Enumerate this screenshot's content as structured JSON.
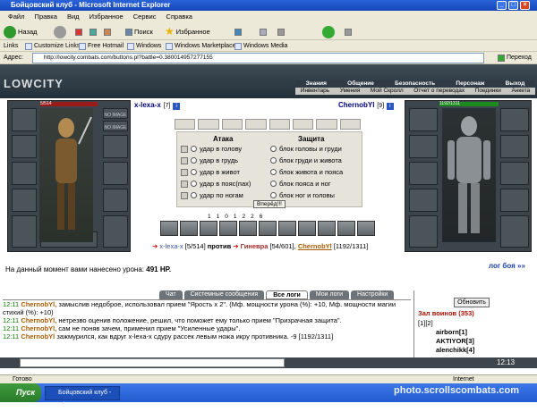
{
  "window": {
    "title": "Бойцовский клуб - Microsoft Internet Explorer"
  },
  "menu": [
    "Файл",
    "Правка",
    "Вид",
    "Избранное",
    "Сервис",
    "Справка"
  ],
  "toolbar": {
    "back": "Назад",
    "search": "Поиск",
    "favorites": "Избранное"
  },
  "links": {
    "label": "Links",
    "items": [
      "Customize Links",
      "Free Hotmail",
      "Windows",
      "Windows Marketplace",
      "Windows Media"
    ]
  },
  "address": {
    "label": "Адрес:",
    "url": "http://lowcity.combats.com/buttons.pl?battle=0.380014957277155",
    "go": "Переход"
  },
  "game": {
    "logo": "LOWCITY",
    "nav": [
      "Знания",
      "Общение",
      "Безопасность",
      "Персонаж",
      "Выход"
    ],
    "subnav": [
      "Инвентарь",
      "Умения",
      "Мой Скролл",
      "Отчет о переводах",
      "Поединки",
      "Анкета"
    ],
    "left_hp": "5/514",
    "right_hp": "1192/1311",
    "no_image": "NO IMAGE",
    "player": {
      "name": "x-lexa-x",
      "level": "[7]",
      "tag": "i"
    },
    "enemy": {
      "name": "ChernobYl",
      "level": "[9]",
      "tag": "i"
    },
    "attack": {
      "header": "Атака",
      "options": [
        "удар в голову",
        "удар в грудь",
        "удар в живот",
        "удар в пояс(пах)",
        "удар по ногам"
      ]
    },
    "defense": {
      "header": "Защита",
      "options": [
        "блок головы и груди",
        "блок груди и живота",
        "блок живота и пояса",
        "блок пояса и ног",
        "блок ног и головы"
      ]
    },
    "forward": "Вперёд!!!",
    "counters": [
      "1",
      "1",
      "0",
      "1",
      "2",
      "2",
      "6"
    ],
    "versus": {
      "p1": "x-lexa-x",
      "p1_hp": "[5/514]",
      "word": "против",
      "p2": "Гиневра",
      "p2_hp": "[54/601],",
      "p3": "ChernobYl",
      "p3_hp": "[1192/1311]"
    },
    "damage": {
      "text": "На данный момент вами нанесено урона:",
      "value": "491 HP."
    },
    "log_link": "лог боя »»"
  },
  "tabs": [
    "Чат",
    "Системные сообщения",
    "Все логи",
    "Мои логи",
    "Настройки"
  ],
  "chat": [
    {
      "time": "12:11",
      "name": "ChernobYl,",
      "text": " замыслив недоброе, использовал прием \"Ярость x 2\". (Мф. мощности урона (%): +10, Мф. мощности магии стихий (%): +10)"
    },
    {
      "time": "12:11",
      "name": "ChernobYl,",
      "text": " нетрезво оценив положение, решил, что поможет ему только прием \"Призрачная защита\"."
    },
    {
      "time": "12:11",
      "name": "ChernobYl,",
      "text": " сам не поняв зачем, применил прием \"Усиленные удары\"."
    },
    {
      "time": "12:11",
      "name": "ChernobYl",
      "text": " зажмурился, как вдруг x-lexa-x сдуру рассек левым ножа икру противника. -9 [1192/1311]"
    }
  ],
  "side": {
    "refresh": "Обновить",
    "title": "Зал воинов (353)",
    "pages": "[1][2]",
    "users": [
      "airborn[1]",
      "AKTIYOR[3]",
      "alenchikk[4]"
    ]
  },
  "status": {
    "left": "Готово",
    "right": "Internet"
  },
  "taskbar": {
    "start": "Пуск",
    "task": "Бойцовский клуб - Mi...",
    "watermark": "photo.scrollscombats.com"
  },
  "clock": "12:13"
}
